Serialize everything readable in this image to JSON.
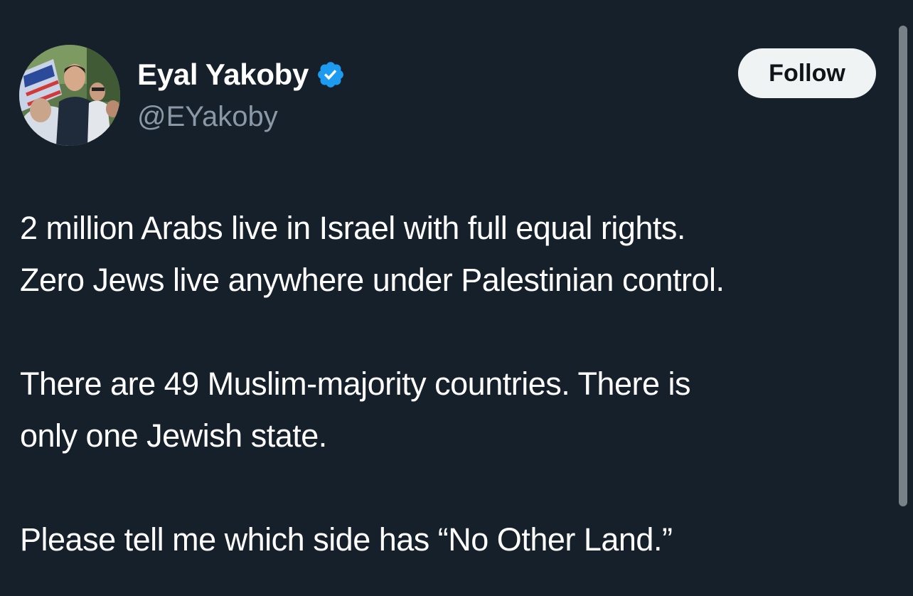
{
  "author": {
    "display_name": "Eyal Yakoby",
    "handle": "@EYakoby",
    "verified": true,
    "verified_icon": "verified-badge-icon",
    "avatar": "profile-photo"
  },
  "actions": {
    "follow_label": "Follow"
  },
  "tweet": {
    "lines": [
      "2 million Arabs live in Israel with full equal rights.",
      "Zero Jews live anywhere under Palestinian control.",
      "There are 49 Muslim-majority countries. There is",
      "only one Jewish state.",
      "Please tell me which side has “No Other Land.”"
    ]
  },
  "colors": {
    "background": "#15202b",
    "text": "#ffffff",
    "secondary_text": "#8b98a5",
    "verified_blue": "#1d9bf0",
    "button_bg": "#eff3f4",
    "button_text": "#0f1419"
  }
}
